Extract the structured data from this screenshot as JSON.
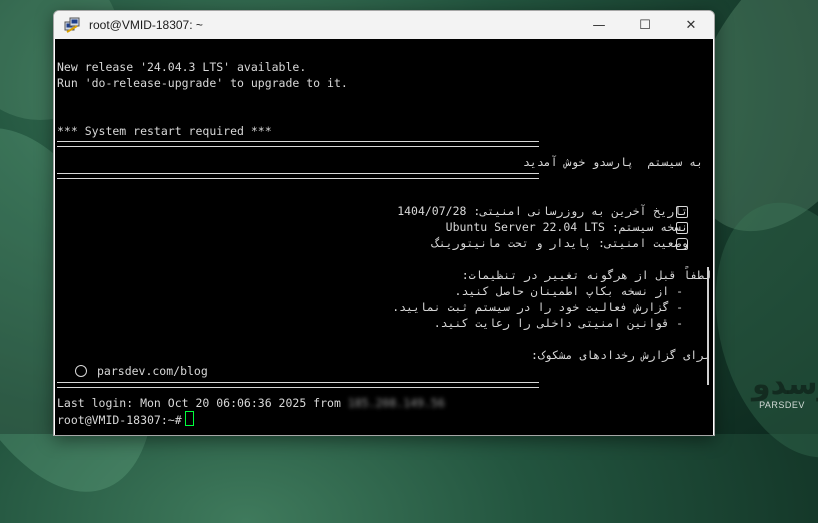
{
  "window": {
    "title": "root@VMID-18307: ~",
    "minimize_glyph": "—",
    "maximize_glyph": "☐",
    "close_glyph": "✕"
  },
  "terminal": {
    "release_line1": "New release '24.04.3 LTS' available.",
    "release_line2": "Run 'do-release-upgrade' to upgrade to it.",
    "restart_line": "*** System restart required ***",
    "welcome": "به سیستم  پارسدو خوش آمدید",
    "security_date": "تاریخ آخرین به روزرسانی امنیتی: 1404/07/28",
    "system_version": "نسخه سیستم: Ubuntu Server 22.04 LTS",
    "security_status": "وضعیت امنیتی: پایدار و تحت مانیتورینگ",
    "notice_heading": "لطفاً قبل از هرگونه تغییر در تنظیمات:",
    "bullet1": "- از نسخه بکاپ اطمینان حاصل کنید.",
    "bullet2": "- گزارش فعالیت خود را در سیستم ثبت نمایید.",
    "bullet3": "- قوانین امنیتی داخلی را رعایت کنید.",
    "report_heading": "برای گزارش رخدادهای مشکوک:",
    "report_link": "parsdev.com/blog",
    "last_login": "Last login: Mon Oct 20 06:06:36 2025 from",
    "last_login_ip": "185.208.149.56",
    "prompt": "root@VMID-18307:~#"
  },
  "watermark": {
    "logo_fa": "پارسدو",
    "logo_en": "PARSDEV"
  },
  "icons": {
    "app": "putty-icon",
    "calendar": "calendar-icon",
    "server": "briefcase-icon",
    "security": "lock-icon",
    "link": "link-icon"
  },
  "colors": {
    "terminal_bg": "#000000",
    "terminal_fg": "#d8d8d8",
    "cursor": "#00ff3c",
    "titlebar": "#f3f3f3"
  }
}
